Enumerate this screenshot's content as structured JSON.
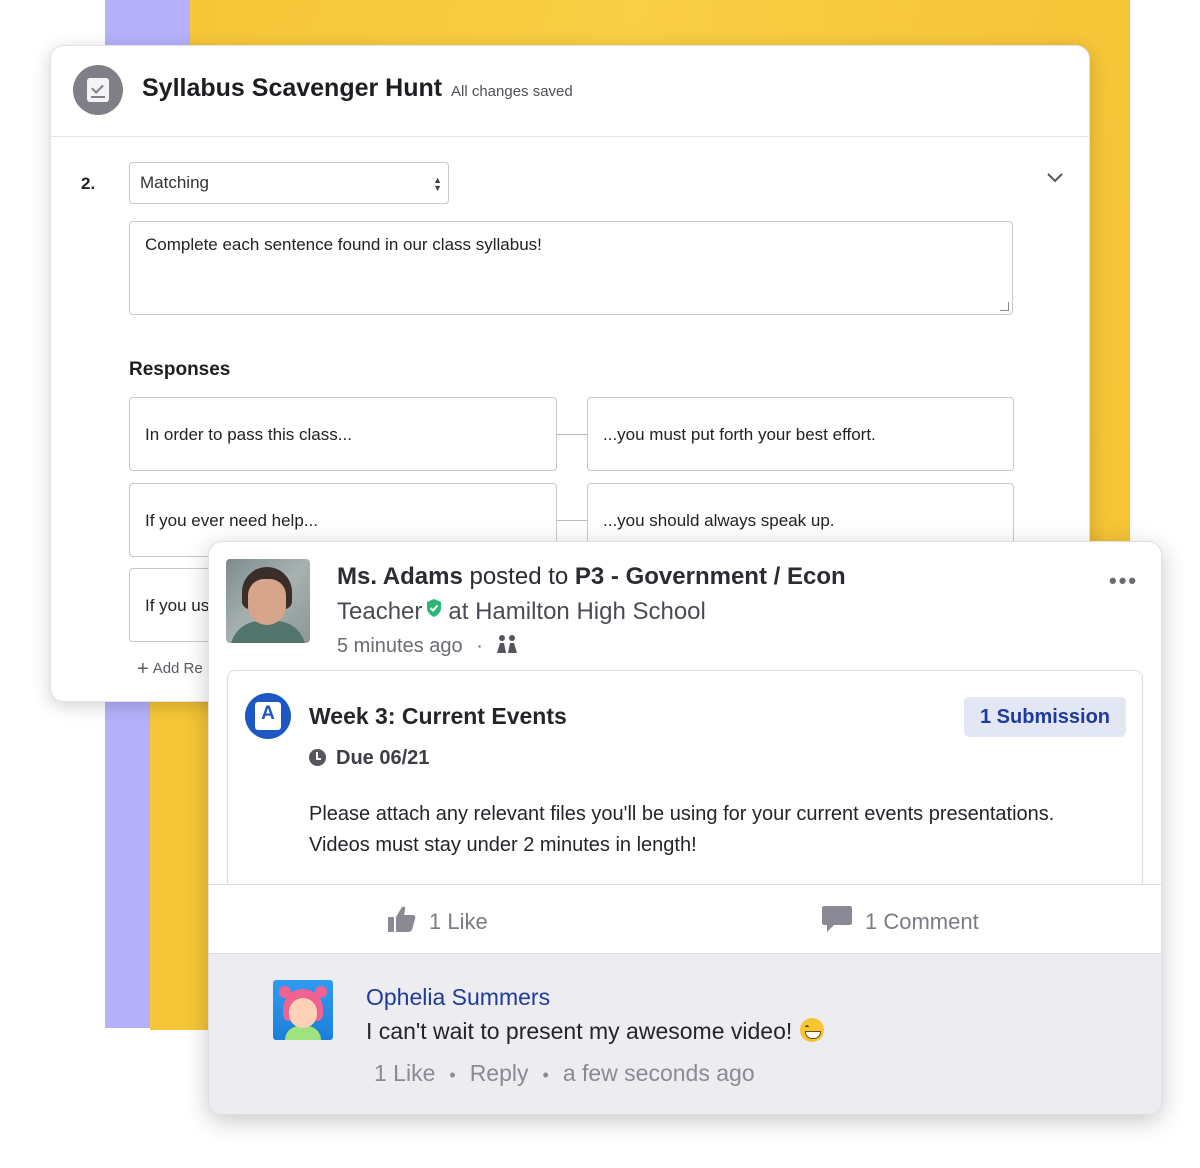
{
  "quiz": {
    "title": "Syllabus Scavenger Hunt",
    "save_status": "All changes saved",
    "question_number": "2.",
    "question_type": "Matching",
    "prompt": "Complete each sentence found in our class syllabus!",
    "responses_heading": "Responses",
    "responses": [
      {
        "left": "In order to pass this class...",
        "right": "...you must put forth your best effort."
      },
      {
        "left": "If you ever need help...",
        "right": "...you should always speak up."
      },
      {
        "left": "If you us",
        "right": ""
      }
    ],
    "add_response_label": "Add Re"
  },
  "post": {
    "author": "Ms. Adams",
    "posted_to_text": "posted to",
    "group": "P3 - Government / Econ",
    "role": "Teacher",
    "school_text": "at Hamilton High School",
    "time": "5 minutes ago",
    "more_label": "•••",
    "assignment": {
      "title": "Week 3: Current Events",
      "submission_badge": "1 Submission",
      "due": "Due 06/21",
      "description": "Please attach any relevant files you'll be using for your current events presentations. Videos must stay under 2 minutes in length!"
    },
    "actions": {
      "like": "1 Like",
      "comment": "1 Comment"
    },
    "comment": {
      "author": "Ophelia Summers",
      "text": "I can't wait to present my awesome video!",
      "likes": "1 Like",
      "reply": "Reply",
      "time": "a few seconds ago"
    }
  },
  "colors": {
    "accent_blue": "#1d57c4",
    "link_navy": "#1e3a9a",
    "background_yellow": "#f6c637",
    "background_purple": "#b5b1fb",
    "verified_green": "#2bb673"
  }
}
